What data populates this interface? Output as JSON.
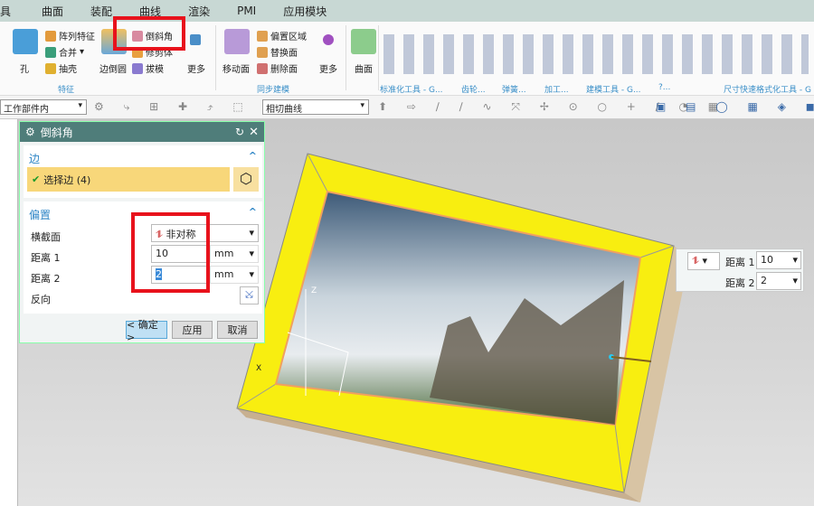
{
  "menu": [
    "具",
    "曲面",
    "装配",
    "曲线",
    "渲染",
    "PMI",
    "应用模块"
  ],
  "ribbon": {
    "hole": "孔",
    "pattern": "阵列特征",
    "unite": "合并",
    "shell": "抽壳",
    "edge_blend": "边倒圆",
    "chamfer": "倒斜角",
    "trim_body": "修剪体",
    "draft": "拔模",
    "more1": "更多",
    "move_face": "移动面",
    "offset_region": "偏置区域",
    "replace_face": "替换面",
    "delete_face": "删除面",
    "more2": "更多",
    "surface": "曲面",
    "groups": [
      "特征",
      "同步建模",
      "标准化工具 - G...",
      "齿轮...",
      "弹簧...",
      "加工...",
      "建模工具 - G...",
      "?...",
      "尺寸快速格式化工具 - G"
    ]
  },
  "toolbar": {
    "filter": "工作部件内",
    "curve_rule": "相切曲线"
  },
  "dialog": {
    "title": "倒斜角",
    "edge_section": "边",
    "select_edge": "选择边 (4)",
    "offset_section": "偏置",
    "cross_section_label": "横截面",
    "cross_section_value": "非对称",
    "distance1_label": "距离 1",
    "distance1_value": "10",
    "distance1_unit": "mm",
    "distance2_label": "距离 2",
    "distance2_value": "2",
    "distance2_unit": "mm",
    "reverse_label": "反向",
    "ok": "< 确定 >",
    "apply": "应用",
    "cancel": "取消"
  },
  "float_panel": {
    "distance1_label": "距离 1",
    "distance1_value": "10",
    "distance2_label": "距离 2",
    "distance2_value": "2"
  },
  "axis": {
    "z": "Z",
    "x": "X"
  }
}
